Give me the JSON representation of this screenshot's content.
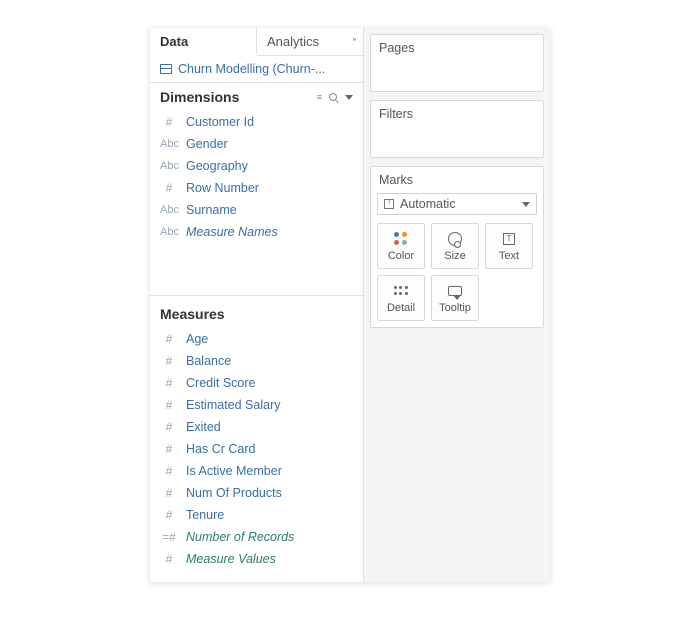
{
  "tabs": {
    "data": "Data",
    "analytics": "Analytics"
  },
  "datasource": {
    "name": "Churn Modelling (Churn-..."
  },
  "dimensions": {
    "title": "Dimensions",
    "items": [
      {
        "type": "#",
        "label": "Customer Id",
        "calc": false
      },
      {
        "type": "Abc",
        "label": "Gender",
        "calc": false
      },
      {
        "type": "Abc",
        "label": "Geography",
        "calc": false
      },
      {
        "type": "#",
        "label": "Row Number",
        "calc": false
      },
      {
        "type": "Abc",
        "label": "Surname",
        "calc": false
      },
      {
        "type": "Abc",
        "label": "Measure Names",
        "calc": true
      }
    ]
  },
  "measures": {
    "title": "Measures",
    "items": [
      {
        "type": "#",
        "label": "Age",
        "calc": false
      },
      {
        "type": "#",
        "label": "Balance",
        "calc": false
      },
      {
        "type": "#",
        "label": "Credit Score",
        "calc": false
      },
      {
        "type": "#",
        "label": "Estimated Salary",
        "calc": false
      },
      {
        "type": "#",
        "label": "Exited",
        "calc": false
      },
      {
        "type": "#",
        "label": "Has Cr Card",
        "calc": false
      },
      {
        "type": "#",
        "label": "Is Active Member",
        "calc": false
      },
      {
        "type": "#",
        "label": "Num Of Products",
        "calc": false
      },
      {
        "type": "#",
        "label": "Tenure",
        "calc": false
      },
      {
        "type": "=#",
        "label": "Number of Records",
        "calc": true,
        "special": true
      },
      {
        "type": "#",
        "label": "Measure Values",
        "calc": true,
        "special": true
      }
    ]
  },
  "shelves": {
    "pages": "Pages",
    "filters": "Filters"
  },
  "marks": {
    "title": "Marks",
    "type": "Automatic",
    "buttons": {
      "color": "Color",
      "size": "Size",
      "text": "Text",
      "detail": "Detail",
      "tooltip": "Tooltip"
    }
  }
}
